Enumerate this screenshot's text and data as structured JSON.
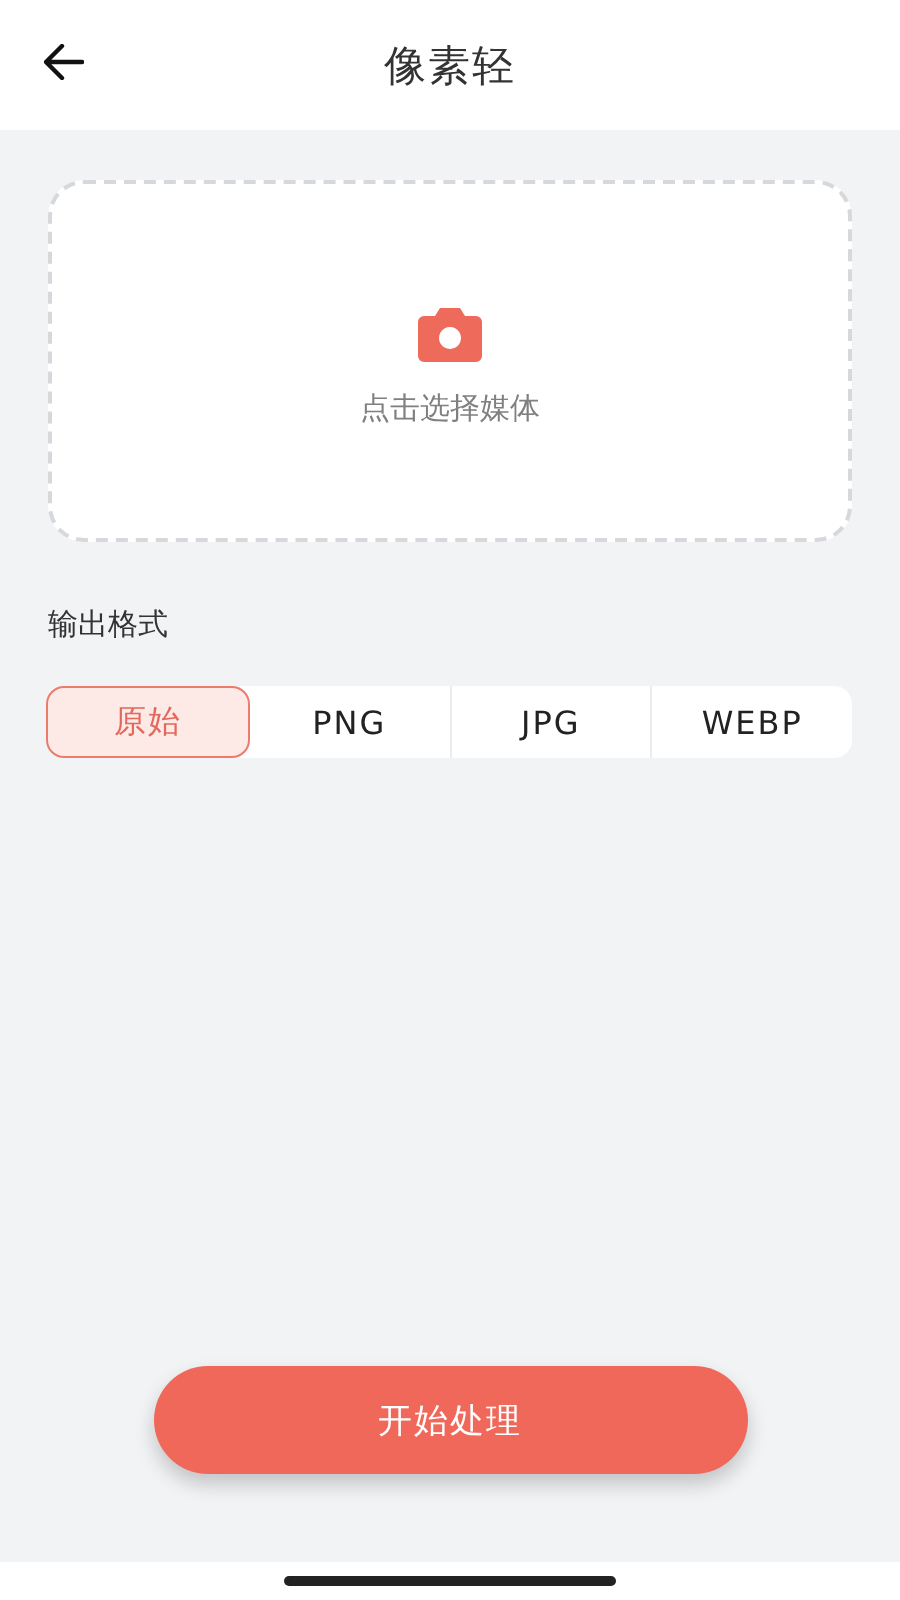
{
  "header": {
    "title": "像素轻"
  },
  "upload": {
    "label": "点击选择媒体"
  },
  "output_format": {
    "label": "输出格式",
    "options": [
      {
        "label": "原始",
        "selected": true
      },
      {
        "label": "PNG",
        "selected": false
      },
      {
        "label": "JPG",
        "selected": false
      },
      {
        "label": "WEBP",
        "selected": false
      }
    ]
  },
  "action_button": {
    "label": "开始处理"
  }
}
